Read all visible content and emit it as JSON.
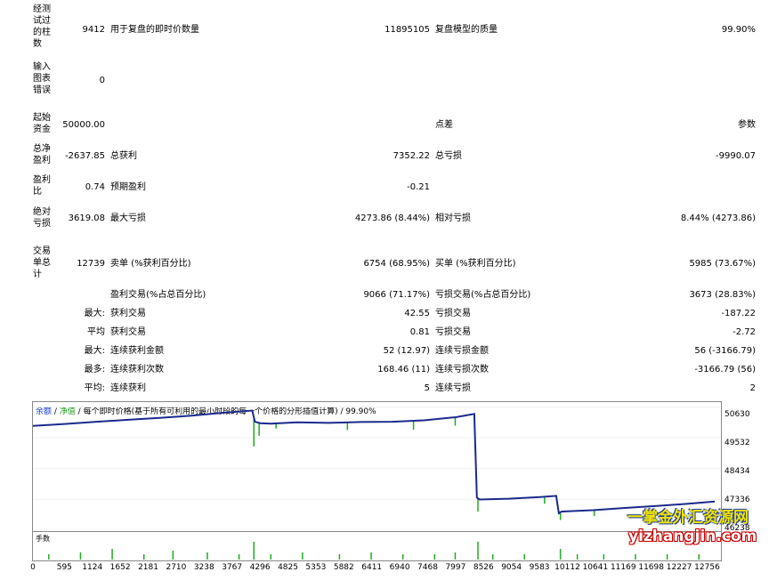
{
  "report": {
    "bars_tested_label": [
      "经测",
      "试过",
      "的柱",
      "数"
    ],
    "bars_tested_value": "9412",
    "ticks_label": "用于复盘的即时价数量",
    "ticks_value": "11895105",
    "quality_label": "复盘模型的质量",
    "quality_value": "99.90%",
    "mismatched_label": [
      "输入",
      "图表",
      "错误"
    ],
    "mismatched_value": "0",
    "deposit_label": [
      "起始",
      "资金"
    ],
    "deposit_value": "50000.00",
    "spread_label": "点差",
    "spread_value": "参数",
    "net_profit_label": [
      "总净",
      "盈利"
    ],
    "net_profit_value": "-2637.85",
    "gross_profit_label": "总获利",
    "gross_profit_value": "7352.22",
    "gross_loss_label": "总亏损",
    "gross_loss_value": "-9990.07",
    "profit_factor_label": [
      "盈利",
      "比"
    ],
    "profit_factor_value": "0.74",
    "expected_payoff_label": "预期盈利",
    "expected_payoff_value": "-0.21",
    "abs_dd_label": [
      "绝对",
      "亏损"
    ],
    "abs_dd_value": "3619.08",
    "max_dd_label": "最大亏损",
    "max_dd_value": "4273.86 (8.44%)",
    "rel_dd_label": "相对亏损",
    "rel_dd_value": "8.44% (4273.86)",
    "total_trades_label": [
      "交易",
      "单总",
      "计"
    ],
    "total_trades_value": "12739",
    "short_label": "卖单 (%获利百分比)",
    "short_value": "6754 (68.95%)",
    "long_label": "买单 (%获利百分比)",
    "long_value": "5985 (73.67%)",
    "profit_trades_label": "盈利交易(%占总百分比)",
    "profit_trades_value": "9066 (71.17%)",
    "loss_trades_label": "亏损交易(%占总百分比)",
    "loss_trades_value": "3673 (28.83%)",
    "largest_prefix": "最大:",
    "largest_profit_label": "获利交易",
    "largest_profit_value": "42.55",
    "largest_loss_label": "亏损交易",
    "largest_loss_value": "-187.22",
    "average_prefix": "平均",
    "avg_profit_label": "获利交易",
    "avg_profit_value": "0.81",
    "avg_loss_label": "亏损交易",
    "avg_loss_value": "-2.72",
    "max_consec_prefix": "最大:",
    "max_consec_wins_label": "连续获利金额",
    "max_consec_wins_value": "52 (12.97)",
    "max_consec_losses_label": "连续亏损金额",
    "max_consec_losses_value": "56 (-3166.79)",
    "max_consec_amt_prefix": "最多:",
    "max_consec_profit_label": "连续获利次数",
    "max_consec_profit_value": "168.46 (11)",
    "max_consec_loss_label": "连续亏损次数",
    "max_consec_loss_value": "-3166.79 (56)",
    "avg_consec_prefix": "平均:",
    "avg_consec_wins_label": "连续获利",
    "avg_consec_wins_value": "5",
    "avg_consec_losses_label": "连续亏损",
    "avg_consec_losses_value": "2"
  },
  "chart_legend": {
    "balance": "余额",
    "sep1": " / ",
    "equity": "净值",
    "sep2": " / ",
    "desc": "每个即时价格(基于所有可利用的最小时段的每一个价格的分形插值计算) / 99.90%"
  },
  "volume_label": "手数",
  "watermark": {
    "line1": "一掌金外汇资源网",
    "line2": "yizhangjin.com"
  },
  "chart_data": {
    "type": "line",
    "title": "",
    "xlabel": "",
    "ylabel": "",
    "x_ticks": [
      0,
      595,
      1124,
      1652,
      2181,
      2710,
      3238,
      3767,
      4296,
      4825,
      5353,
      5882,
      6411,
      6940,
      7468,
      7997,
      8526,
      9054,
      9583,
      10112,
      10641,
      11169,
      11698,
      12227,
      12756
    ],
    "y_ticks": [
      50630,
      49532,
      48434,
      47336,
      46238
    ],
    "ylim": [
      46238,
      50800
    ],
    "xlim": [
      0,
      13000
    ],
    "series": [
      {
        "name": "余额",
        "color": "#1a2a8c",
        "x": [
          0,
          600,
          1200,
          1800,
          2400,
          3000,
          3600,
          4150,
          4200,
          4300,
          4500,
          5000,
          5600,
          6200,
          6800,
          7400,
          8000,
          8350,
          8400,
          8450,
          9000,
          9600,
          9900,
          9950,
          10000,
          10600,
          11200,
          11800,
          12400,
          12900
        ],
        "y": [
          49950,
          50020,
          50100,
          50170,
          50240,
          50320,
          50420,
          50500,
          50100,
          50050,
          50030,
          50080,
          50060,
          50090,
          50100,
          50150,
          50260,
          50380,
          47400,
          47330,
          47360,
          47420,
          47460,
          46840,
          46900,
          46950,
          47030,
          47100,
          47180,
          47260
        ]
      }
    ],
    "equity_drops": [
      {
        "x": 4180,
        "y": 49220
      },
      {
        "x": 4280,
        "y": 49600
      },
      {
        "x": 4600,
        "y": 49860
      },
      {
        "x": 5950,
        "y": 49800
      },
      {
        "x": 7200,
        "y": 49820
      },
      {
        "x": 7990,
        "y": 49960
      },
      {
        "x": 8420,
        "y": 46900
      },
      {
        "x": 9680,
        "y": 47180
      },
      {
        "x": 9980,
        "y": 46600
      },
      {
        "x": 10620,
        "y": 46740
      }
    ],
    "volume_spikes": [
      {
        "x": 300,
        "v": 0.3
      },
      {
        "x": 900,
        "v": 0.4
      },
      {
        "x": 1500,
        "v": 0.6
      },
      {
        "x": 2100,
        "v": 0.3
      },
      {
        "x": 2650,
        "v": 0.5
      },
      {
        "x": 3300,
        "v": 0.4
      },
      {
        "x": 3900,
        "v": 0.3
      },
      {
        "x": 4180,
        "v": 1.0
      },
      {
        "x": 4500,
        "v": 0.3
      },
      {
        "x": 5100,
        "v": 0.4
      },
      {
        "x": 5800,
        "v": 0.3
      },
      {
        "x": 6400,
        "v": 0.4
      },
      {
        "x": 7000,
        "v": 0.3
      },
      {
        "x": 7600,
        "v": 0.3
      },
      {
        "x": 7990,
        "v": 0.4
      },
      {
        "x": 8420,
        "v": 1.0
      },
      {
        "x": 8700,
        "v": 0.3
      },
      {
        "x": 9300,
        "v": 0.3
      },
      {
        "x": 9980,
        "v": 0.6
      },
      {
        "x": 10300,
        "v": 0.3
      },
      {
        "x": 10800,
        "v": 0.3
      },
      {
        "x": 11400,
        "v": 0.3
      },
      {
        "x": 12000,
        "v": 0.3
      },
      {
        "x": 12600,
        "v": 0.3
      }
    ]
  }
}
